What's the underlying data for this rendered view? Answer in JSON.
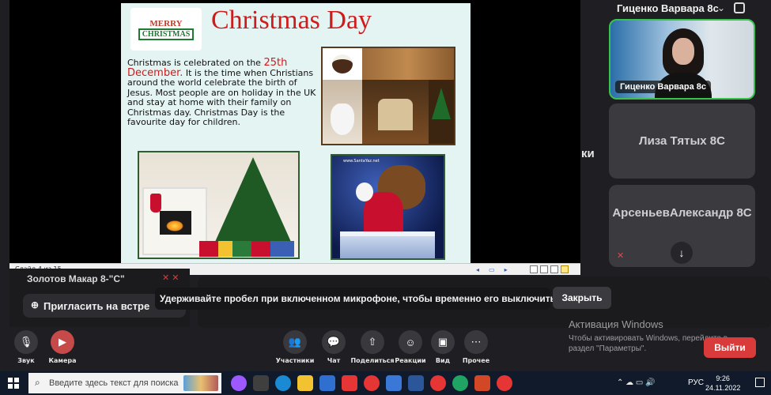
{
  "slide": {
    "title": "Christmas Day",
    "logo_line1": "MERRY",
    "logo_line2": "CHRISTMAS",
    "text_before": "Christmas is celebrated on the ",
    "text_highlight": "25th December.",
    "text_after": " It is the time when Christians around the world celebrate the birth of Jesus. Most people are on holiday in the UK and stay at home with their family on Christmas day. Christmas Day is the favourite day for children.",
    "santa_site": "www.SantaYaz.net",
    "counter": "Слайд 4 из 15"
  },
  "participants": {
    "me_name": "Гиценко Варвара 8с",
    "me_label": "Гиценко Варвара 8с",
    "tile_b": "Лиза Тятых 8С",
    "tile_c_line1": "Арсеньев",
    "tile_c_line2": "Александр 8С",
    "edge_fragment": "ки"
  },
  "left_list": {
    "name": "Золотов Макар 8-\"С\"",
    "invite_label": "Пригласить на встре"
  },
  "toast": {
    "message": "Удерживайте пробел при включенном микрофоне, чтобы временно его выключить",
    "close_label": "Закрыть"
  },
  "windows_activation": {
    "title": "Активация Windows",
    "line1": "Чтобы активировать Windows, перейдите в",
    "line2": "раздел \"Параметры\"."
  },
  "exit_label": "Выйти",
  "controls": {
    "sound": {
      "label": "Звук",
      "icon": "mic-icon"
    },
    "camera": {
      "label": "Камера",
      "icon": "camera-off-icon"
    },
    "participants": {
      "label": "Участники",
      "icon": "people-icon"
    },
    "chat": {
      "label": "Чат",
      "icon": "chat-icon"
    },
    "share": {
      "label": "Поделиться",
      "icon": "share-screen-icon"
    },
    "reactions": {
      "label": "Реакции",
      "icon": "smile-icon"
    },
    "view": {
      "label": "Вид",
      "icon": "layout-icon"
    },
    "more": {
      "label": "Прочее",
      "icon": "more-icon"
    }
  },
  "taskbar": {
    "search_placeholder": "Введите здесь текст для поиска",
    "lang": "РУС",
    "time": "9:26",
    "date": "24.11.2022"
  },
  "colors": {
    "accent_green": "#3ac24d",
    "danger_red": "#d93a3a",
    "slide_title_red": "#d11a1a"
  }
}
